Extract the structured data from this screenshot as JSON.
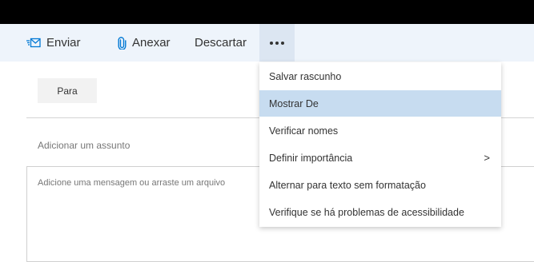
{
  "toolbar": {
    "send_label": "Enviar",
    "attach_label": "Anexar",
    "discard_label": "Descartar"
  },
  "compose": {
    "to_label": "Para",
    "subject_placeholder": "Adicionar um assunto",
    "body_placeholder": "Adicione uma mensagem ou arraste um arquivo"
  },
  "menu": {
    "items": [
      {
        "label": "Salvar rascunho"
      },
      {
        "label": "Mostrar De"
      },
      {
        "label": "Verificar nomes"
      },
      {
        "label": "Definir importância"
      },
      {
        "label": "Alternar para texto sem formatação"
      },
      {
        "label": "Verifique se há problemas de acessibilidade"
      }
    ],
    "highlighted_index": 1,
    "submenu_indicator": ">"
  },
  "colors": {
    "accent": "#0078d4",
    "toolbar_bg": "#eef4fb",
    "highlight": "#c7dcf0"
  },
  "icons": [
    "send-icon",
    "paperclip-icon",
    "more-options-icon",
    "chevron-right-icon"
  ]
}
